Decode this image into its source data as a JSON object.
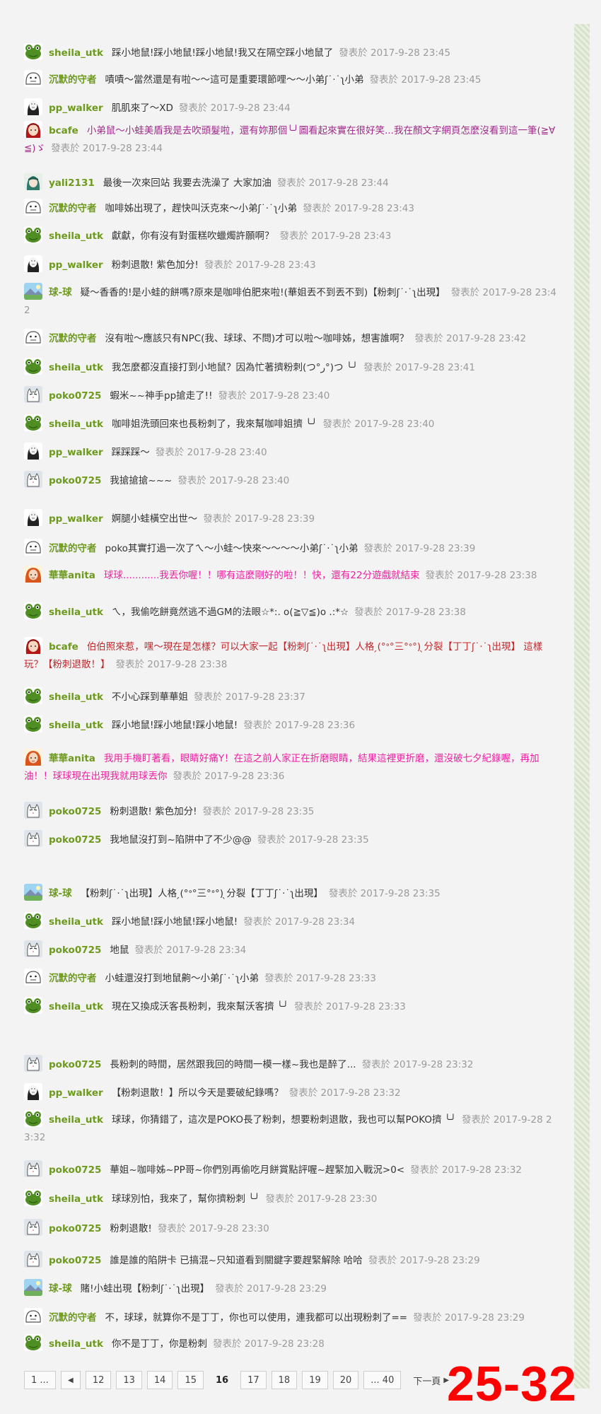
{
  "colors": {
    "background": "#f3f3f3",
    "timestamp": "#9a9a9a",
    "user_green": "#6d9a1d",
    "user_purple": "#a12a8c",
    "user_pink": "#ee1fa2",
    "overlay_red": "#ff0000"
  },
  "posted_label": "發表於",
  "posts": [
    {
      "user": "sheila_utk",
      "avatar": "frog-avatar-icon",
      "user_color": "#6d9a1d",
      "text_color": "#333333",
      "text": "踩小地鼠!踩小地鼠!踩小地鼠!我又在隔空踩小地鼠了",
      "time": "2017-9-28 23:45"
    },
    {
      "user": "沉默的守者",
      "avatar": "ghost-avatar-icon",
      "user_color": "#6d9a1d",
      "text_color": "#333333",
      "text": "嘖嘖～當然還是有啦～～這可是重要環節哩～～小弟ʃ˙‧˙ʅ小弟",
      "time": "2017-9-28 23:45"
    },
    {
      "user": "pp_walker",
      "avatar": "noface-avatar-icon",
      "user_color": "#6d9a1d",
      "text_color": "#333333",
      "text": "肌肌來了～XD",
      "time": "2017-9-28 23:44"
    },
    {
      "user": "bcafe",
      "avatar": "girl-avatar-icon",
      "user_color": "#6d9a1d",
      "text_color": "#a12a8c",
      "text": "小弟鼠～小蛙美盾我是去吹頭髮啦，還有妳那個╰╯圖看起來實在很好笑...我在顏文字網頁怎麼沒看到這一筆(≧∀≦)ゞ",
      "time": "2017-9-28 23:44"
    },
    {
      "user": "yali2131",
      "avatar": "anime-avatar-icon",
      "user_color": "#6d9a1d",
      "text_color": "#333333",
      "text": "最後一次來回站 我要去洗澡了 大家加油",
      "time": "2017-9-28 23:44"
    },
    {
      "user": "沉默的守者",
      "avatar": "ghost-avatar-icon",
      "user_color": "#6d9a1d",
      "text_color": "#333333",
      "text": "咖啡姊出現了，趕快叫沃克來～小弟ʃ˙‧˙ʅ小弟",
      "time": "2017-9-28 23:43"
    },
    {
      "user": "sheila_utk",
      "avatar": "frog-avatar-icon",
      "user_color": "#6d9a1d",
      "text_color": "#333333",
      "text": "獻獻，你有沒有對蛋糕吹蠟燭許願啊？",
      "time": "2017-9-28 23:43"
    },
    {
      "user": "pp_walker",
      "avatar": "noface-avatar-icon",
      "user_color": "#6d9a1d",
      "text_color": "#333333",
      "text": "粉刺退散! 紫色加分!",
      "time": "2017-9-28 23:43"
    },
    {
      "user": "球-球",
      "avatar": "landscape-avatar-icon",
      "user_color": "#6d9a1d",
      "text_color": "#333333",
      "text": "疑～香香的!是小蛙的餅嗎?原來是咖啡伯肥來啦!(華姐丟不到丟不到)【粉刺ʃ˙‧˙ʅ出現】",
      "time": "2017-9-28 23:42"
    },
    {
      "user": "沉默的守者",
      "avatar": "ghost-avatar-icon",
      "user_color": "#6d9a1d",
      "text_color": "#333333",
      "text": "沒有啦～應該只有NPC(我、球球、不問)才可以啦～咖啡姊，想害誰啊？",
      "time": "2017-9-28 23:42"
    },
    {
      "user": "sheila_utk",
      "avatar": "frog-avatar-icon",
      "user_color": "#6d9a1d",
      "text_color": "#333333",
      "text": "我怎麼都沒直接打到小地鼠？因為忙著擠粉刺(つ°ر°)つ ╰╯",
      "time": "2017-9-28 23:41"
    },
    {
      "user": "poko0725",
      "avatar": "cat-avatar-icon",
      "user_color": "#6d9a1d",
      "text_color": "#333333",
      "text": "蝦米~~神手pp搶走了!!",
      "time": "2017-9-28 23:40"
    },
    {
      "user": "sheila_utk",
      "avatar": "frog-avatar-icon",
      "user_color": "#6d9a1d",
      "text_color": "#333333",
      "text": "咖啡姐洗頭回來也長粉刺了，我來幫咖啡姐擠 ╰╯",
      "time": "2017-9-28 23:40"
    },
    {
      "user": "pp_walker",
      "avatar": "noface-avatar-icon",
      "user_color": "#6d9a1d",
      "text_color": "#333333",
      "text": "踩踩踩～",
      "time": "2017-9-28 23:40"
    },
    {
      "user": "poko0725",
      "avatar": "cat-avatar-icon",
      "user_color": "#6d9a1d",
      "text_color": "#333333",
      "text": "我搶搶搶~~~",
      "time": "2017-9-28 23:40"
    },
    {
      "user": "pp_walker",
      "avatar": "noface-avatar-icon",
      "user_color": "#6d9a1d",
      "text_color": "#333333",
      "text": "婀腿小蛙橫空出世～",
      "time": "2017-9-28 23:39"
    },
    {
      "user": "沉默的守者",
      "avatar": "ghost-avatar-icon",
      "user_color": "#6d9a1d",
      "text_color": "#333333",
      "text": "poko其實打過一次了ㄟ～小蛙～快來～～～～小弟ʃ˙‧˙ʅ小弟",
      "time": "2017-9-28 23:39"
    },
    {
      "user": "華華anita",
      "avatar": "redhair-avatar-icon",
      "user_color": "#6d9a1d",
      "text_color": "#ee1fa2",
      "text": "球球............我丟你喔！！哪有這麼剛好的啦！！快，還有22分遊戲就結束",
      "time": "2017-9-28 23:38"
    },
    {
      "user": "sheila_utk",
      "avatar": "frog-avatar-icon",
      "user_color": "#6d9a1d",
      "text_color": "#333333",
      "text": "ㄟ，我偷吃餅竟然逃不過GM的法眼☆*:. o(≧▽≦)o .:*☆",
      "time": "2017-9-28 23:38"
    },
    {
      "user": "bcafe",
      "avatar": "girl-avatar-icon",
      "user_color": "#6d9a1d",
      "text_color": "#c0282d",
      "text": "伯伯照來惹，嘿～現在是怎樣？可以大家一起【粉刺ʃ˙‧˙ʅ出現】人格 ̗(°ᐤ°三°ᐤ°) ̖分裂【丁丁ʃ˙‧˙ʅ出現】 這樣玩？【粉刺退散！】",
      "time": "2017-9-28 23:38"
    },
    {
      "user": "sheila_utk",
      "avatar": "frog-avatar-icon",
      "user_color": "#6d9a1d",
      "text_color": "#333333",
      "text": "不小心踩到華華姐",
      "time": "2017-9-28 23:37"
    },
    {
      "user": "sheila_utk",
      "avatar": "frog-avatar-icon",
      "user_color": "#6d9a1d",
      "text_color": "#333333",
      "text": "踩小地鼠!踩小地鼠!踩小地鼠!",
      "time": "2017-9-28 23:36"
    },
    {
      "user": "華華anita",
      "avatar": "redhair-avatar-icon",
      "user_color": "#6d9a1d",
      "text_color": "#ee1fa2",
      "text": "我用手機盯著看，眼睛好痛Y！在這之前人家正在折磨眼睛，結果這裡更折磨，還沒破七夕紀錄喔，再加油！！球球現在出現我就用球丟你",
      "time": "2017-9-28 23:36"
    },
    {
      "user": "poko0725",
      "avatar": "cat-avatar-icon",
      "user_color": "#6d9a1d",
      "text_color": "#333333",
      "text": "粉刺退散! 紫色加分!",
      "time": "2017-9-28 23:35"
    },
    {
      "user": "poko0725",
      "avatar": "cat-avatar-icon",
      "user_color": "#6d9a1d",
      "text_color": "#333333",
      "text": "我地鼠沒打到~陷阱中了不少@@",
      "time": "2017-9-28 23:35"
    },
    {
      "user": "球-球",
      "avatar": "landscape-avatar-icon",
      "user_color": "#6d9a1d",
      "text_color": "#333333",
      "text": "【粉刺ʃ˙‧˙ʅ出現】人格 ̗(°ᐤ°三°ᐤ°) ̖分裂【丁丁ʃ˙‧˙ʅ出現】",
      "time": "2017-9-28 23:35"
    },
    {
      "user": "sheila_utk",
      "avatar": "frog-avatar-icon",
      "user_color": "#6d9a1d",
      "text_color": "#333333",
      "text": "踩小地鼠!踩小地鼠!踩小地鼠!",
      "time": "2017-9-28 23:34"
    },
    {
      "user": "poko0725",
      "avatar": "cat-avatar-icon",
      "user_color": "#6d9a1d",
      "text_color": "#333333",
      "text": "地鼠",
      "time": "2017-9-28 23:34"
    },
    {
      "user": "沉默的守者",
      "avatar": "ghost-avatar-icon",
      "user_color": "#6d9a1d",
      "text_color": "#333333",
      "text": "小蛙還沒打到地鼠齁～小弟ʃ˙‧˙ʅ小弟",
      "time": "2017-9-28 23:33"
    },
    {
      "user": "sheila_utk",
      "avatar": "frog-avatar-icon",
      "user_color": "#6d9a1d",
      "text_color": "#333333",
      "text": "現在又換成沃客長粉刺，我來幫沃客擠 ╰╯",
      "time": "2017-9-28 23:33"
    },
    {
      "user": "poko0725",
      "avatar": "cat-avatar-icon",
      "user_color": "#6d9a1d",
      "text_color": "#333333",
      "text": "長粉刺的時間，居然跟我回的時間一模一樣~我也是醉了...",
      "time": "2017-9-28 23:32"
    },
    {
      "user": "pp_walker",
      "avatar": "noface-avatar-icon",
      "user_color": "#6d9a1d",
      "text_color": "#333333",
      "text": "【粉刺退散！】所以今天是要破紀錄嗎？",
      "time": "2017-9-28 23:32"
    },
    {
      "user": "sheila_utk",
      "avatar": "frog-avatar-icon",
      "user_color": "#6d9a1d",
      "text_color": "#333333",
      "text": "球球，你猜錯了，這次是POKO長了粉刺，想要粉刺退散，我也可以幫POKO擠 ╰╯",
      "time": "2017-9-28 23:32"
    },
    {
      "user": "poko0725",
      "avatar": "cat-avatar-icon",
      "user_color": "#6d9a1d",
      "text_color": "#333333",
      "text": "華姐~咖啡姊~PP哥~你們別再偷吃月餅賞點評喔~趕緊加入戰況>0<",
      "time": "2017-9-28 23:32"
    },
    {
      "user": "sheila_utk",
      "avatar": "frog-avatar-icon",
      "user_color": "#6d9a1d",
      "text_color": "#333333",
      "text": "球球別怕，我來了，幫你擠粉刺 ╰╯",
      "time": "2017-9-28 23:30"
    },
    {
      "user": "poko0725",
      "avatar": "cat-avatar-icon",
      "user_color": "#6d9a1d",
      "text_color": "#333333",
      "text": "粉刺退散!",
      "time": "2017-9-28 23:30"
    },
    {
      "user": "poko0725",
      "avatar": "cat-avatar-icon",
      "user_color": "#6d9a1d",
      "text_color": "#333333",
      "text": "誰是誰的陷阱卡 已搞混~只知道看到關鍵字要趕緊解除 哈哈",
      "time": "2017-9-28 23:29"
    },
    {
      "user": "球-球",
      "avatar": "landscape-avatar-icon",
      "user_color": "#6d9a1d",
      "text_color": "#333333",
      "text": "賭!小蛙出現【粉刺ʃ˙‧˙ʅ出現】",
      "time": "2017-9-28 23:29"
    },
    {
      "user": "沉默的守者",
      "avatar": "ghost-avatar-icon",
      "user_color": "#6d9a1d",
      "text_color": "#333333",
      "text": "不，球球，就算你不是丁丁，你也可以使用，連我都可以出現粉刺了==",
      "time": "2017-9-28 23:29"
    },
    {
      "user": "sheila_utk",
      "avatar": "frog-avatar-icon",
      "user_color": "#6d9a1d",
      "text_color": "#333333",
      "text": "你不是丁丁，你是粉刺",
      "time": "2017-9-28 23:28"
    }
  ],
  "pagination": {
    "first": "1 ...",
    "pages": [
      "12",
      "13",
      "14",
      "15",
      "16",
      "17",
      "18",
      "19",
      "20"
    ],
    "current": "16",
    "last": "... 40",
    "next": "下一頁"
  },
  "overlay_range": "25-32"
}
